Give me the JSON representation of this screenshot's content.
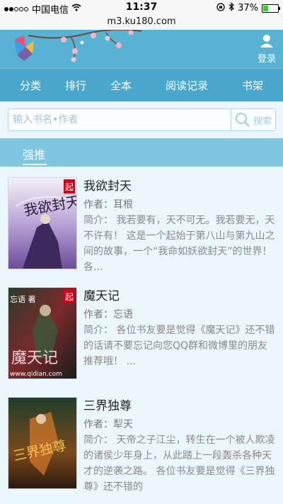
{
  "status_bar": {
    "carrier": "中国电信",
    "time": "11:37",
    "battery": "37%"
  },
  "url": "m3.ku180.com",
  "header": {
    "login_label": "登录"
  },
  "nav": {
    "items": [
      "分类",
      "排行",
      "全本",
      "阅读记录",
      "书架"
    ]
  },
  "search": {
    "placeholder": "输入书名•作者",
    "button_label": "搜索"
  },
  "section": {
    "title": "强推"
  },
  "books": [
    {
      "title": "我欲封天",
      "author_label": "作者：",
      "author": "耳根",
      "intro_label": "简介：",
      "intro": "我若要有，天不可无。我若要无，天不许有！ 这是一个起始于第八山与第九山之间的故事，一个“我命如妖欲封天”的世界！ 各...",
      "cover_text": "我欲封天",
      "badge": "起"
    },
    {
      "title": "魔天记",
      "author_label": "作者：",
      "author": "忘语",
      "intro_label": "简介：",
      "intro": "各位书友要是觉得《魔天记》还不错的话请不要忘记向您QQ群和微博里的朋友推荐哦！ ...",
      "cover_text": "魔天记",
      "cover_site": "www.qidian.com",
      "cover_author": "忘语 著",
      "badge": "起"
    },
    {
      "title": "三界独尊",
      "author_label": "作者：",
      "author": "犁天",
      "intro_label": "简介：",
      "intro": "天帝之子江尘，转生在一个被人欺凌的诸侯少年身上，从此踏上一段轰杀各种天才的逆袭之路。 各位书友要是觉得《三界独尊》还不错的",
      "cover_text": "三界独尊"
    }
  ],
  "colors": {
    "header": "#58b2d3",
    "nav": "#4aa7cc",
    "section": "#7ec6df",
    "background": "#eaf6fb"
  }
}
